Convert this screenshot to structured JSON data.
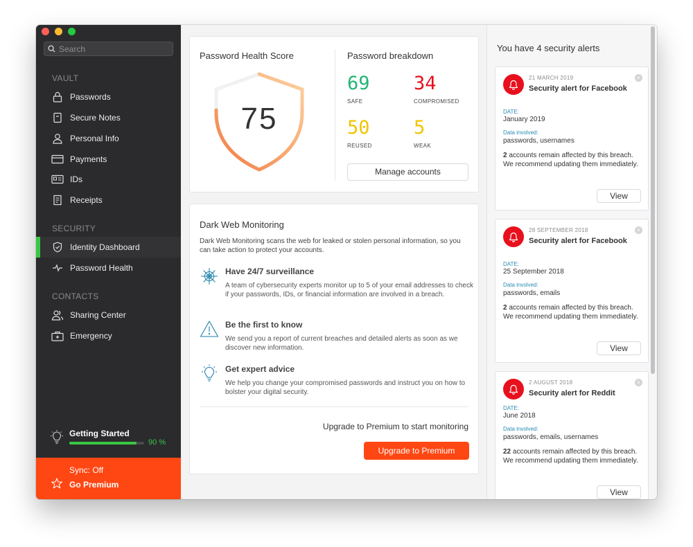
{
  "sidebar": {
    "search_placeholder": "Search",
    "sections": {
      "vault": "VAULT",
      "security": "SECURITY",
      "contacts": "CONTACTS"
    },
    "vault_items": [
      "Passwords",
      "Secure Notes",
      "Personal Info",
      "Payments",
      "IDs",
      "Receipts"
    ],
    "security_items": [
      "Identity Dashboard",
      "Password Health"
    ],
    "contacts_items": [
      "Sharing Center",
      "Emergency"
    ],
    "active_item": "Identity Dashboard",
    "getting_started": {
      "label": "Getting Started",
      "percent_text": "90 %",
      "progress": 0.9
    },
    "premium": {
      "sync": "Sync: Off",
      "go_premium": "Go Premium"
    }
  },
  "health": {
    "title": "Password Health Score",
    "score": "75",
    "breakdown_title": "Password breakdown",
    "stats": {
      "safe": {
        "value": "69",
        "label": "SAFE",
        "color": "#22b573"
      },
      "compromised": {
        "value": "34",
        "label": "COMPROMISED",
        "color": "#e8101d"
      },
      "reused": {
        "value": "50",
        "label": "REUSED",
        "color": "#f2c400"
      },
      "weak": {
        "value": "5",
        "label": "WEAK",
        "color": "#f2c400"
      }
    },
    "manage_button": "Manage accounts"
  },
  "darkweb": {
    "title": "Dark Web Monitoring",
    "description": "Dark Web Monitoring scans the web for leaked or stolen personal information, so you can take action to protect your accounts.",
    "features": [
      {
        "icon": "spider-web-icon",
        "title": "Have 24/7 surveillance",
        "description": "A team of cybersecurity experts monitor up to 5 of your email addresses to check if your passwords, IDs, or financial information are involved in a breach."
      },
      {
        "icon": "warning-icon",
        "title": "Be the first to know",
        "description": "We send you a report of current breaches and detailed alerts as soon as we discover new information."
      },
      {
        "icon": "lightbulb-icon",
        "title": "Get expert advice",
        "description": "We help you change your compromised passwords and instruct you on how to bolster your digital security."
      }
    ],
    "upgrade_text": "Upgrade to Premium to start monitoring",
    "upgrade_button": "Upgrade to Premium"
  },
  "alerts": {
    "title": "You have 4 security alerts",
    "items": [
      {
        "date": "21 MARCH 2019",
        "title": "Security alert for Facebook",
        "date_label": "DATE:",
        "date_value": "January 2019",
        "data_label": "Data involved:",
        "data_value": "passwords, usernames",
        "count": "2",
        "note": " accounts remain affected by this breach. We recommend updating them immediately.",
        "view": "View"
      },
      {
        "date": "28 SEPTEMBER 2018",
        "title": "Security alert for Facebook",
        "date_label": "DATE:",
        "date_value": "25 September 2018",
        "data_label": "Data involved:",
        "data_value": "passwords, emails",
        "count": "2",
        "note": " accounts remain affected by this breach. We recommend updating them immediately.",
        "view": "View"
      },
      {
        "date": "2 AUGUST 2018",
        "title": "Security alert for Reddit",
        "date_label": "DATE:",
        "date_value": "June 2018",
        "data_label": "Data involved:",
        "data_value": "passwords, emails, usernames",
        "count": "22",
        "note": " accounts remain affected by this breach. We recommend updating them immediately.",
        "view": "View"
      }
    ]
  }
}
